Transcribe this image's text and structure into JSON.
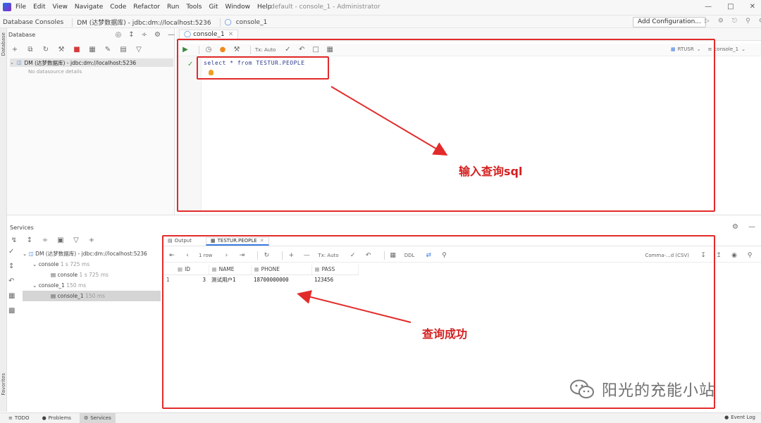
{
  "menu": [
    "File",
    "Edit",
    "View",
    "Navigate",
    "Code",
    "Refactor",
    "Run",
    "Tools",
    "Git",
    "Window",
    "Help"
  ],
  "window_title": "default - console_1 - Administrator",
  "breadcrumbs": [
    "Database Consoles",
    "DM (达梦数据库) - jdbc:dm://localhost:5236",
    "console_1"
  ],
  "add_config_label": "Add Configuration...",
  "left_strip": {
    "top": "Database",
    "bottom": "Favorites"
  },
  "db_panel": {
    "title": "Database",
    "tree_item": "DM (达梦数据库) - jdbc:dm://localhost:5236",
    "empty_hint": "No datasource details"
  },
  "editor": {
    "tab_label": "console_1",
    "tx_mode": "Tx: Auto",
    "sql": "select * from TESTUR.PEOPLE",
    "right_schema": "RTUSR",
    "right_console": "console_1"
  },
  "annotations": {
    "input_note": "输入查询sql",
    "success_note": "查询成功"
  },
  "services": {
    "title": "Services",
    "tree": [
      {
        "label": "DM (达梦数据库) - jdbc:dm://localhost:5236",
        "level": 0
      },
      {
        "label": "console",
        "time": "1 s 725 ms",
        "level": 1
      },
      {
        "label": "console",
        "time": "1 s 725 ms",
        "level": 2
      },
      {
        "label": "console_1",
        "time": "150 ms",
        "level": 1
      },
      {
        "label": "console_1",
        "time": "150 ms",
        "level": 2
      }
    ]
  },
  "results": {
    "tab_output": "Output",
    "tab_table": "TESTUR.PEOPLE",
    "rows_label": "1 row",
    "tx_mode": "Tx: Auto",
    "ddl_label": "DDL",
    "export_label": "Comma-...d (CSV)",
    "columns": [
      "ID",
      "NAME",
      "PHONE",
      "PASS"
    ],
    "rows": [
      {
        "row_number": "1",
        "ID": "3",
        "NAME": "测试用户1",
        "PHONE": "18700000000",
        "PASS": "123456"
      }
    ]
  },
  "watermark": "阳光的充能小站",
  "status_bar": {
    "todo": "TODO",
    "problems": "Problems",
    "services": "Services",
    "event_log": "Event Log"
  },
  "colors": {
    "annotation_red": "#e32a2a",
    "accent_blue": "#3a7be0"
  }
}
